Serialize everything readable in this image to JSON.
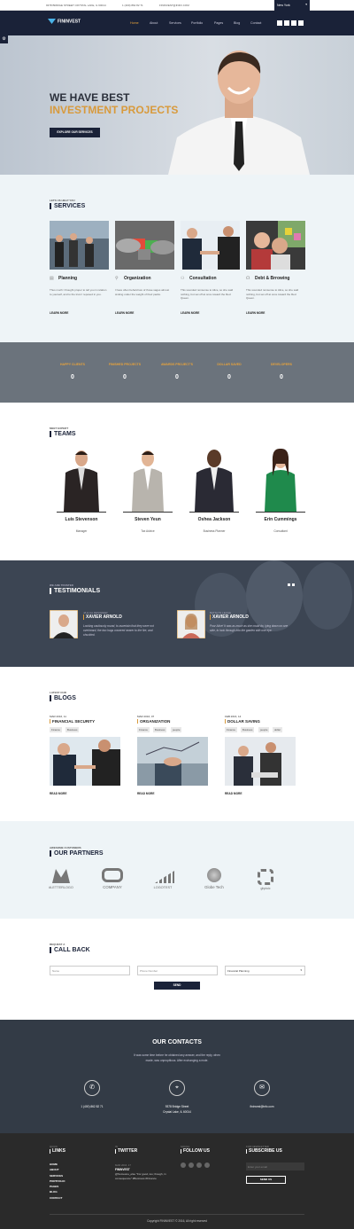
{
  "topbar": {
    "address": "9378 BRIDGE STREET CRYSTAL LAKE, IL 60014",
    "phone": "1 (400) 862 82 71",
    "email": "FININVEST@INFO.COM",
    "city": "New York"
  },
  "nav": {
    "logo": "FININVEST",
    "items": [
      "Home",
      "About",
      "Services",
      "Portfolio",
      "Pages",
      "Blog",
      "Contact"
    ]
  },
  "hero": {
    "line1": "WE HAVE BEST",
    "line2": "INVESTMENT PROJECTS",
    "button": "EXPLORE OUR SERVICES"
  },
  "services": {
    "subtitle": "LETS US HELP YOU",
    "title": "SERVICES",
    "more": "LEARN MORE",
    "items": [
      {
        "title": "Planning",
        "text": "Thus much I thought proper to tell you in relation to yourself, and to the trust I reposed in you."
      },
      {
        "title": "Organization",
        "text": "I have often beheld two of those sages almost sinking under the weight of their packs."
      },
      {
        "title": "Consultation",
        "text": "This sounded nonsense to Alice, so she said nothing, but set off at once toward the Red Queen."
      },
      {
        "title": "Debt & Brrowing",
        "text": "This sounded nonsense to Alice, so she said nothing, but set off at once toward the Red Queen."
      }
    ]
  },
  "stats": [
    {
      "label": "HAPPY CLIENTS",
      "value": "0"
    },
    {
      "label": "FINISHED PROJECTS",
      "value": "0"
    },
    {
      "label": "AWARDS PROJECT'S",
      "value": "0"
    },
    {
      "label": "DOLLAR SAVED",
      "value": "0"
    },
    {
      "label": "DEVELOPERS",
      "value": "0"
    }
  ],
  "teams": {
    "subtitle": "MEET EXPERT",
    "title": "TEAMS",
    "members": [
      {
        "name": "Luis Stevenson",
        "role": "Manager"
      },
      {
        "name": "Steven Yeun",
        "role": "Tax Advice"
      },
      {
        "name": "Oshea Jackson",
        "role": "Business Planner"
      },
      {
        "name": "Erin Cummings",
        "role": "Consultant"
      }
    ]
  },
  "testimonials": {
    "subtitle": "WE ARE TRUSTED",
    "title": "TESTIMONIALS",
    "items": [
      {
        "meta": "JA & CA DESIGNER",
        "name": "XAVIER ARNOLD",
        "text": "Looking cautiously round, to ascertain that they were not overheard, the two hags cowered nearer to the fire, and chuckled."
      },
      {
        "meta": "BATSLYN LEAGE",
        "name": "XAVIER ARNOLD",
        "text": "Poor Alice! It was as much as she could do, lying down on one side, to look through into the garden with one eye."
      }
    ]
  },
  "blogs": {
    "subtitle": "LATEST OUR",
    "title": "BLOGS",
    "more": "READ MORE",
    "items": [
      {
        "date": "MAR 2016, 11",
        "title": "FINANCIAL SECURITY",
        "tags": [
          "Finance",
          "Business"
        ]
      },
      {
        "date": "MAR 2016, 07",
        "title": "ORGANIZATION",
        "tags": [
          "Finance",
          "Business",
          "people"
        ]
      },
      {
        "date": "FEB 2016, 14",
        "title": "DOLLAR SAVING",
        "tags": [
          "Finance",
          "Business",
          "people",
          "dollar"
        ]
      }
    ]
  },
  "partners": {
    "subtitle": "AWESOME CUSTOMERS",
    "title": "OUR PARTNERS",
    "logos": [
      "#LETTERLOGO",
      "COMPANY",
      "LOGOTEST",
      "Globe Tech",
      "ghpiuic"
    ]
  },
  "callback": {
    "subtitle": "REQUEST A",
    "title": "CALL BACK",
    "name_ph": "Name",
    "phone_ph": "Phone Number",
    "select": "Financial Planning",
    "send": "SEND"
  },
  "contacts": {
    "title": "OUR CONTACTS",
    "text1": "It was some time before he obtained any answer, and the reply, when",
    "text2": "made, was unpropitious. After exchanging a mute.",
    "phone": "1 (400) 862 82 71",
    "addr1": "9378 Bridge Street",
    "addr2": "Crystal Lake, IL 60014",
    "email": "fininvest@info.com"
  },
  "footer": {
    "links": {
      "sub": "QUICK",
      "title": "LINKS",
      "items": [
        "HOME",
        "ABOUT",
        "SERVICES",
        "PORTFOLIO",
        "PAGES",
        "BLOG",
        "CONTACT"
      ]
    },
    "twitter": {
      "sub": "IN",
      "title": "TWITTER",
      "date": "MAR 2016, 17",
      "handle": "FININVEST",
      "tweet": "@Someone_else \"For good, too; though, in consequence\" #Business #Finance"
    },
    "social": {
      "sub": "SOCIAL",
      "title": "FOLLOW US"
    },
    "news": {
      "sub": "FOR NEWSLETTER",
      "title": "SUBSCRIBE US",
      "placeholder": "Enter your email",
      "button": "SEND US"
    },
    "copyright": "Copyright FININVEST © 2016, All right reserved"
  },
  "colors": {
    "navy": "#1a2238",
    "accent": "#d89a3c",
    "dark": "#3c4553"
  }
}
